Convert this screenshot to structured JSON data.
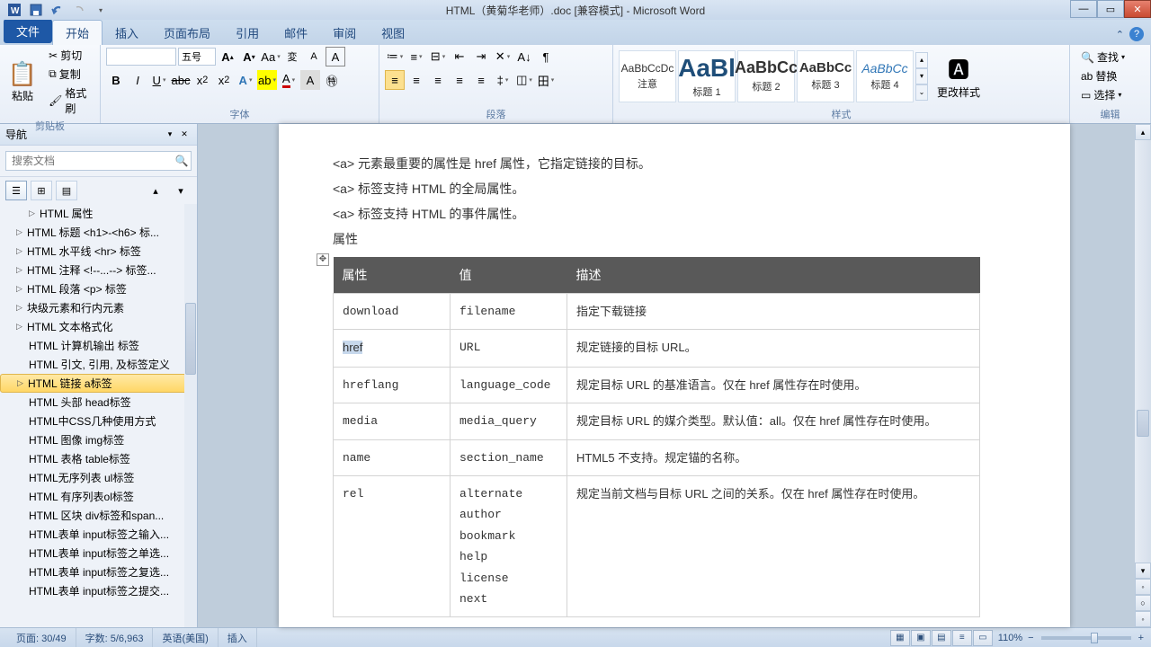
{
  "window": {
    "title": "HTML（黄菊华老师）.doc [兼容模式] - Microsoft Word"
  },
  "tabs": {
    "file": "文件",
    "items": [
      "开始",
      "插入",
      "页面布局",
      "引用",
      "邮件",
      "审阅",
      "视图"
    ]
  },
  "ribbon": {
    "clipboard": {
      "label": "剪贴板",
      "paste": "粘贴",
      "cut": "剪切",
      "copy": "复制",
      "format_painter": "格式刷"
    },
    "font": {
      "label": "字体",
      "size_text": "五号"
    },
    "paragraph": {
      "label": "段落"
    },
    "styles": {
      "label": "样式",
      "change": "更改样式",
      "items": [
        {
          "preview": "AaBbCcDc",
          "name": "注意"
        },
        {
          "preview": "AaBl",
          "name": "标题 1"
        },
        {
          "preview": "AaBbCc",
          "name": "标题 2"
        },
        {
          "preview": "AaBbCc",
          "name": "标题 3"
        },
        {
          "preview": "AaBbCc",
          "name": "标题 4"
        }
      ]
    },
    "editing": {
      "label": "编辑",
      "find": "查找",
      "replace": "替换",
      "select": "选择"
    }
  },
  "nav": {
    "title": "导航",
    "search_placeholder": "搜索文档",
    "items": [
      {
        "text": "HTML 属性",
        "indent": true,
        "exp": "▷"
      },
      {
        "text": "HTML 标题 <h1>-<h6> 标...",
        "exp": "▷"
      },
      {
        "text": "HTML 水平线 <hr> 标签",
        "exp": "▷"
      },
      {
        "text": "HTML 注释 <!--...--> 标签...",
        "exp": "▷"
      },
      {
        "text": "HTML 段落 <p> 标签",
        "exp": "▷"
      },
      {
        "text": "块级元素和行内元素",
        "exp": "▷"
      },
      {
        "text": "HTML 文本格式化",
        "exp": "▷"
      },
      {
        "text": "HTML 计算机输出 标签",
        "indent": true
      },
      {
        "text": "HTML 引文, 引用, 及标签定义",
        "indent": true
      },
      {
        "text": "HTML 链接 a标签",
        "active": true,
        "exp": "▷"
      },
      {
        "text": "HTML 头部 head标签",
        "indent": true
      },
      {
        "text": "HTML中CSS几种使用方式",
        "indent": true
      },
      {
        "text": "HTML 图像 img标签",
        "indent": true
      },
      {
        "text": "HTML 表格 table标签",
        "indent": true
      },
      {
        "text": "HTML无序列表 ul标签",
        "indent": true
      },
      {
        "text": "HTML 有序列表ol标签",
        "indent": true
      },
      {
        "text": "HTML 区块 div标签和span...",
        "indent": true
      },
      {
        "text": "HTML表单 input标签之输入...",
        "indent": true
      },
      {
        "text": "HTML表单 input标签之单选...",
        "indent": true
      },
      {
        "text": "HTML表单 input标签之复选...",
        "indent": true
      },
      {
        "text": "HTML表单 input标签之提交...",
        "indent": true
      }
    ]
  },
  "doc": {
    "p1": "<a> 元素最重要的属性是 href 属性，它指定链接的目标。",
    "p2": "<a> 标签支持 HTML 的全局属性。",
    "p3": "<a> 标签支持 HTML 的事件属性。",
    "section": "属性",
    "table": {
      "headers": [
        "属性",
        "值",
        "描述"
      ],
      "rows": [
        {
          "attr": "download",
          "val": "filename",
          "desc": "指定下载链接"
        },
        {
          "attr": "href",
          "val": "URL",
          "desc": "规定链接的目标 URL。",
          "sel": true
        },
        {
          "attr": "hreflang",
          "val": "language_code",
          "desc": "规定目标 URL 的基准语言。仅在 href 属性存在时使用。"
        },
        {
          "attr": "media",
          "val": "media_query",
          "desc": "规定目标 URL 的媒介类型。默认值：all。仅在 href 属性存在时使用。"
        },
        {
          "attr": "name",
          "val": "section_name",
          "desc": "HTML5 不支持。规定锚的名称。"
        },
        {
          "attr": "rel",
          "val": "alternate\nauthor\nbookmark\nhelp\nlicense\nnext",
          "desc": "规定当前文档与目标 URL 之间的关系。仅在 href 属性存在时使用。"
        }
      ]
    }
  },
  "status": {
    "page": "页面: 30/49",
    "words": "字数: 5/6,963",
    "lang": "英语(美国)",
    "mode": "插入",
    "zoom": "110%"
  }
}
